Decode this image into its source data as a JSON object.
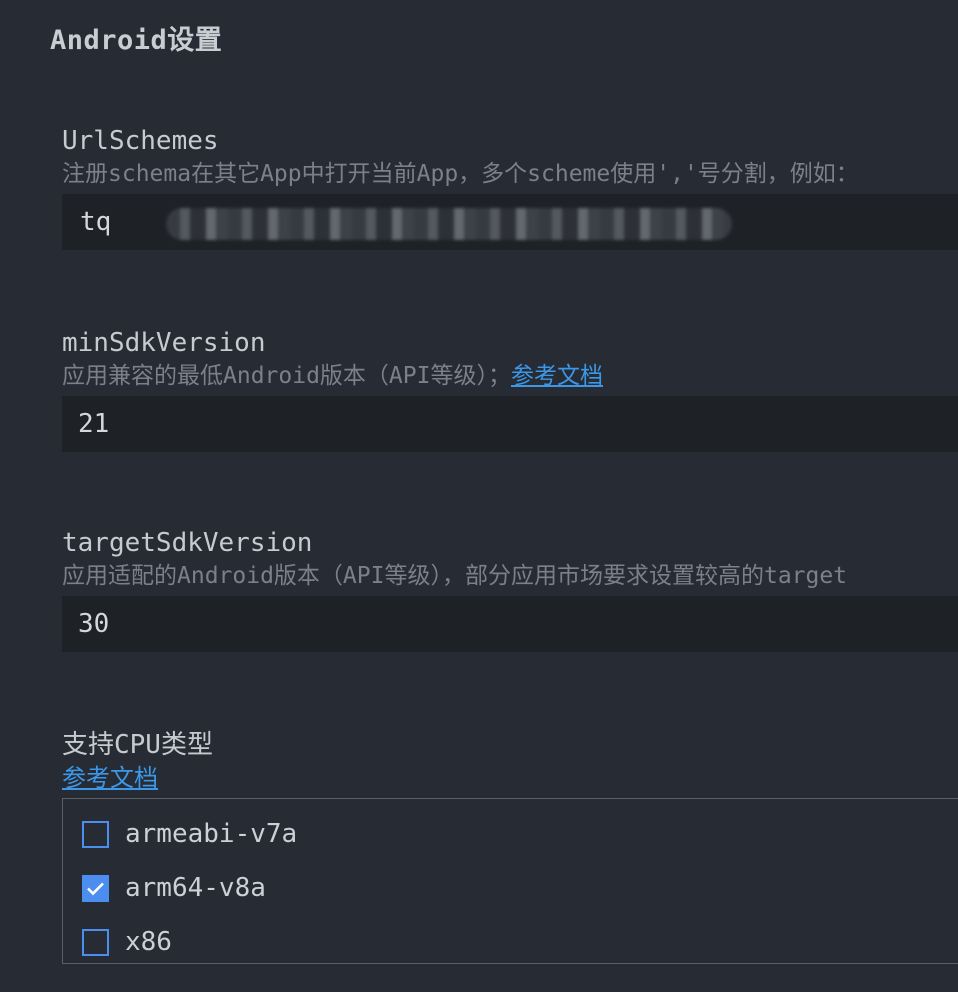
{
  "section_title": "Android设置",
  "url_schemes": {
    "label": "UrlSchemes",
    "description": "注册schema在其它App中打开当前App，多个scheme使用','号分割，例如：",
    "value": "tq"
  },
  "min_sdk": {
    "label": "minSdkVersion",
    "description": "应用兼容的最低Android版本（API等级）；",
    "link_text": "参考文档",
    "value": "21"
  },
  "target_sdk": {
    "label": "targetSdkVersion",
    "description": "应用适配的Android版本（API等级），部分应用市场要求设置较高的target",
    "value": "30"
  },
  "cpu": {
    "label": "支持CPU类型",
    "link_text": "参考文档",
    "options": [
      {
        "label": "armeabi-v7a",
        "checked": false
      },
      {
        "label": "arm64-v8a",
        "checked": true
      },
      {
        "label": "x86",
        "checked": false
      }
    ]
  },
  "colors": {
    "background": "#272b33",
    "input_background": "#1e2126",
    "accent": "#4b8ef0",
    "link": "#3b97e8"
  }
}
